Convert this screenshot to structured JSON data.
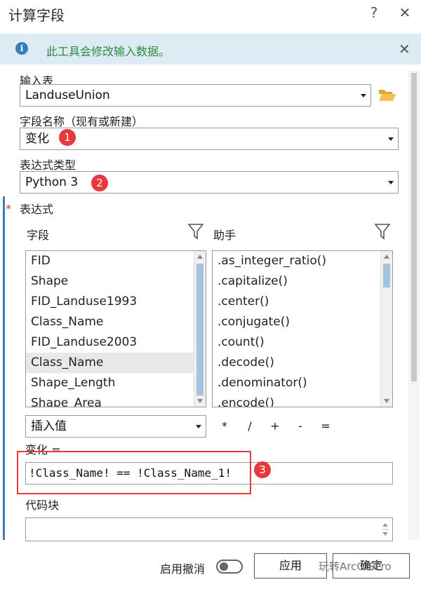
{
  "dialog": {
    "title": "计算字段",
    "help_icon": "question-mark-icon",
    "close_icon": "close-icon"
  },
  "info_bar": {
    "icon": "info-icon",
    "icon_glyph": "i",
    "text": "此工具会修改输入数据。"
  },
  "input_table": {
    "label": "输入表",
    "value": "LanduseUnion",
    "folder_icon": "folder-open-icon"
  },
  "field_name": {
    "label": "字段名称（现有或新建）",
    "value": "变化",
    "badge": "1"
  },
  "expression_type": {
    "label": "表达式类型",
    "value": "Python 3",
    "badge": "2"
  },
  "expression": {
    "required_mark": "*",
    "label": "表达式",
    "fields_header": "字段",
    "helpers_header": "助手",
    "fields": [
      "FID",
      "Shape",
      "FID_Landuse1993",
      "Class_Name",
      "FID_Landuse2003",
      "Class_Name",
      "Shape_Length",
      "Shape_Area"
    ],
    "selected_field_index": 5,
    "helpers": [
      ".as_integer_ratio()",
      ".capitalize()",
      ".center()",
      ".conjugate()",
      ".count()",
      ".decode()",
      ".denominator()",
      ".encode()"
    ],
    "insert_value_label": "插入值",
    "operators": [
      "*",
      "/",
      "+",
      "-",
      "="
    ],
    "target_label": "变化 =",
    "text": "!Class_Name! == !Class_Name_1!",
    "badge": "3",
    "highlight_color": "#e8383d"
  },
  "code_block": {
    "label": "代码块"
  },
  "footer": {
    "undo_label": "启用撤消",
    "apply_label": "应用",
    "ok_label": "确定",
    "watermark": "玩转ArcGISPro"
  },
  "colors": {
    "info_background": "#dcebf4",
    "info_text": "#2f8a3f",
    "badge": "#e8383d",
    "accent": "#3b7cbf"
  }
}
